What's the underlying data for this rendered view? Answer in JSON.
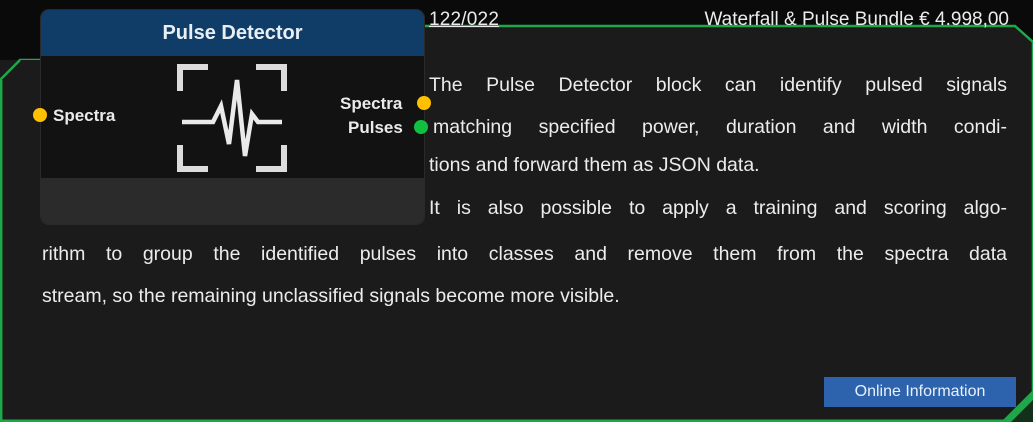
{
  "header": {
    "code": "122/022",
    "bundle_price": "Waterfall & Pulse Bundle € 4.998,00"
  },
  "node": {
    "title": "Pulse Detector",
    "icon": "pulse-detector-icon",
    "input_port": {
      "label": "Spectra",
      "color": "#ffc000"
    },
    "output_ports": [
      {
        "label": "Spectra",
        "color": "#ffc000"
      },
      {
        "label": "Pulses",
        "color": "#10c040"
      }
    ]
  },
  "description": {
    "lines": [
      "The Pulse Detector block can identify pulsed signals",
      "matching specified power, duration and width condi-",
      "tions and forward them as JSON data.",
      "It is also possible to apply a training and scoring algo-",
      "rithm to group the identified pulses into classes and remove them from the spectra data",
      "stream, so the remaining unclassified signals become more visible."
    ]
  },
  "button": {
    "label": "Online Information"
  },
  "colors": {
    "accent": "#1ea84a",
    "node_header": "#0f3d68",
    "button": "#2d63ad",
    "background": "#0a0a0a"
  }
}
